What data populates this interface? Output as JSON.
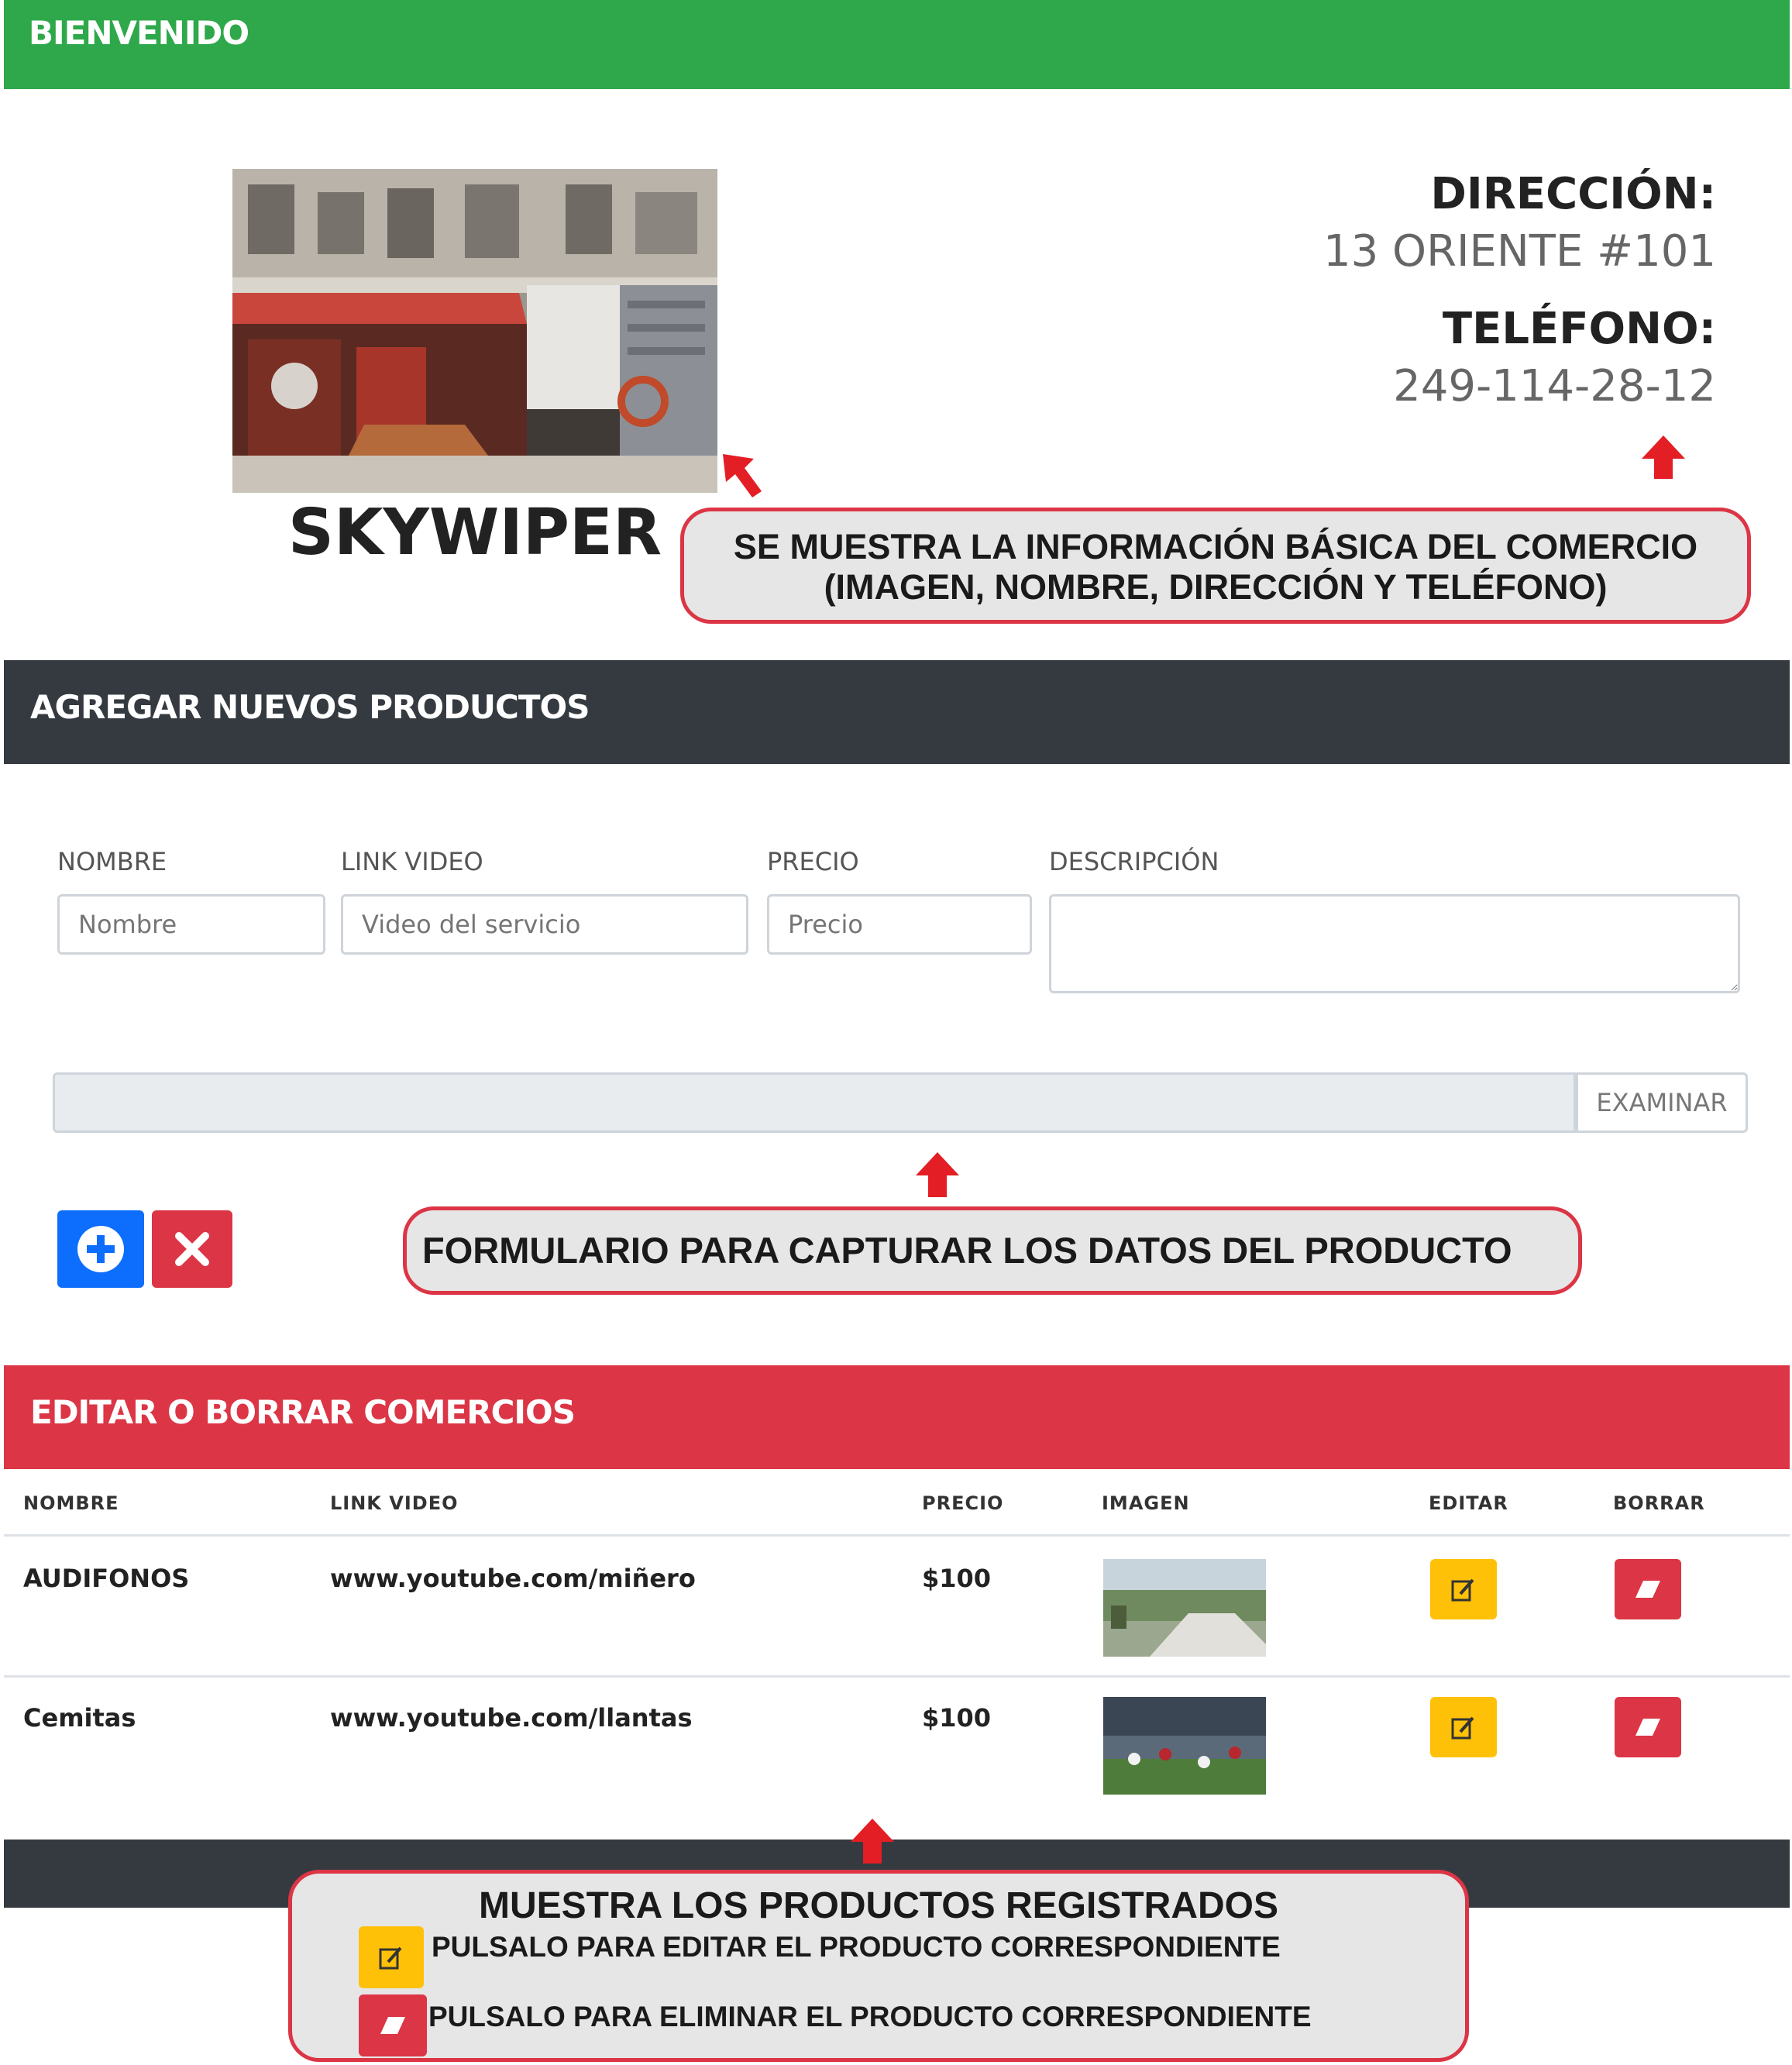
{
  "header": {
    "title": "BIENVENIDO"
  },
  "store": {
    "name": "SKYWIPER",
    "address_label": "DIRECCIÓN:",
    "address": "13 ORIENTE #101",
    "phone_label": "TELÉFONO:",
    "phone": "249-114-28-12"
  },
  "callouts": {
    "store_info": [
      "SE MUESTRA LA INFORMACIÓN BÁSICA DEL COMERCIO",
      "(IMAGEN, NOMBRE, DIRECCIÓN Y TELÉFONO)"
    ],
    "form": "FORMULARIO PARA CAPTURAR LOS DATOS DEL PRODUCTO",
    "list_title": "MUESTRA LOS PRODUCTOS REGISTRADOS",
    "list_edit": "PULSALO PARA EDITAR EL PRODUCTO CORRESPONDIENTE",
    "list_delete": "PULSALO PARA ELIMINAR EL PRODUCTO CORRESPONDIENTE"
  },
  "add_section": {
    "title": "AGREGAR NUEVOS PRODUCTOS",
    "fields": {
      "name": {
        "label": "NOMBRE",
        "placeholder": "Nombre"
      },
      "video": {
        "label": "LINK VIDEO",
        "placeholder": "Video del servicio"
      },
      "price": {
        "label": "PRECIO",
        "placeholder": "Precio"
      },
      "description": {
        "label": "DESCRIPCIÓN",
        "placeholder": ""
      }
    },
    "file_button": "EXAMINAR",
    "add_icon": "plus-circle-icon",
    "cancel_icon": "x-icon"
  },
  "edit_section": {
    "title": "EDITAR O BORRAR COMERCIOS",
    "columns": [
      "NOMBRE",
      "LINK VIDEO",
      "PRECIO",
      "IMAGEN",
      "EDITAR",
      "BORRAR"
    ],
    "rows": [
      {
        "name": "AUDIFONOS",
        "video": "www.youtube.com/miñero",
        "price": "$100"
      },
      {
        "name": "Cemitas",
        "video": "www.youtube.com/llantas",
        "price": "$100"
      }
    ]
  },
  "colors": {
    "header": "#2ea84a",
    "dark_bar": "#343a40",
    "danger": "#dc3545",
    "warning": "#ffc107",
    "primary": "#0d6efd"
  }
}
